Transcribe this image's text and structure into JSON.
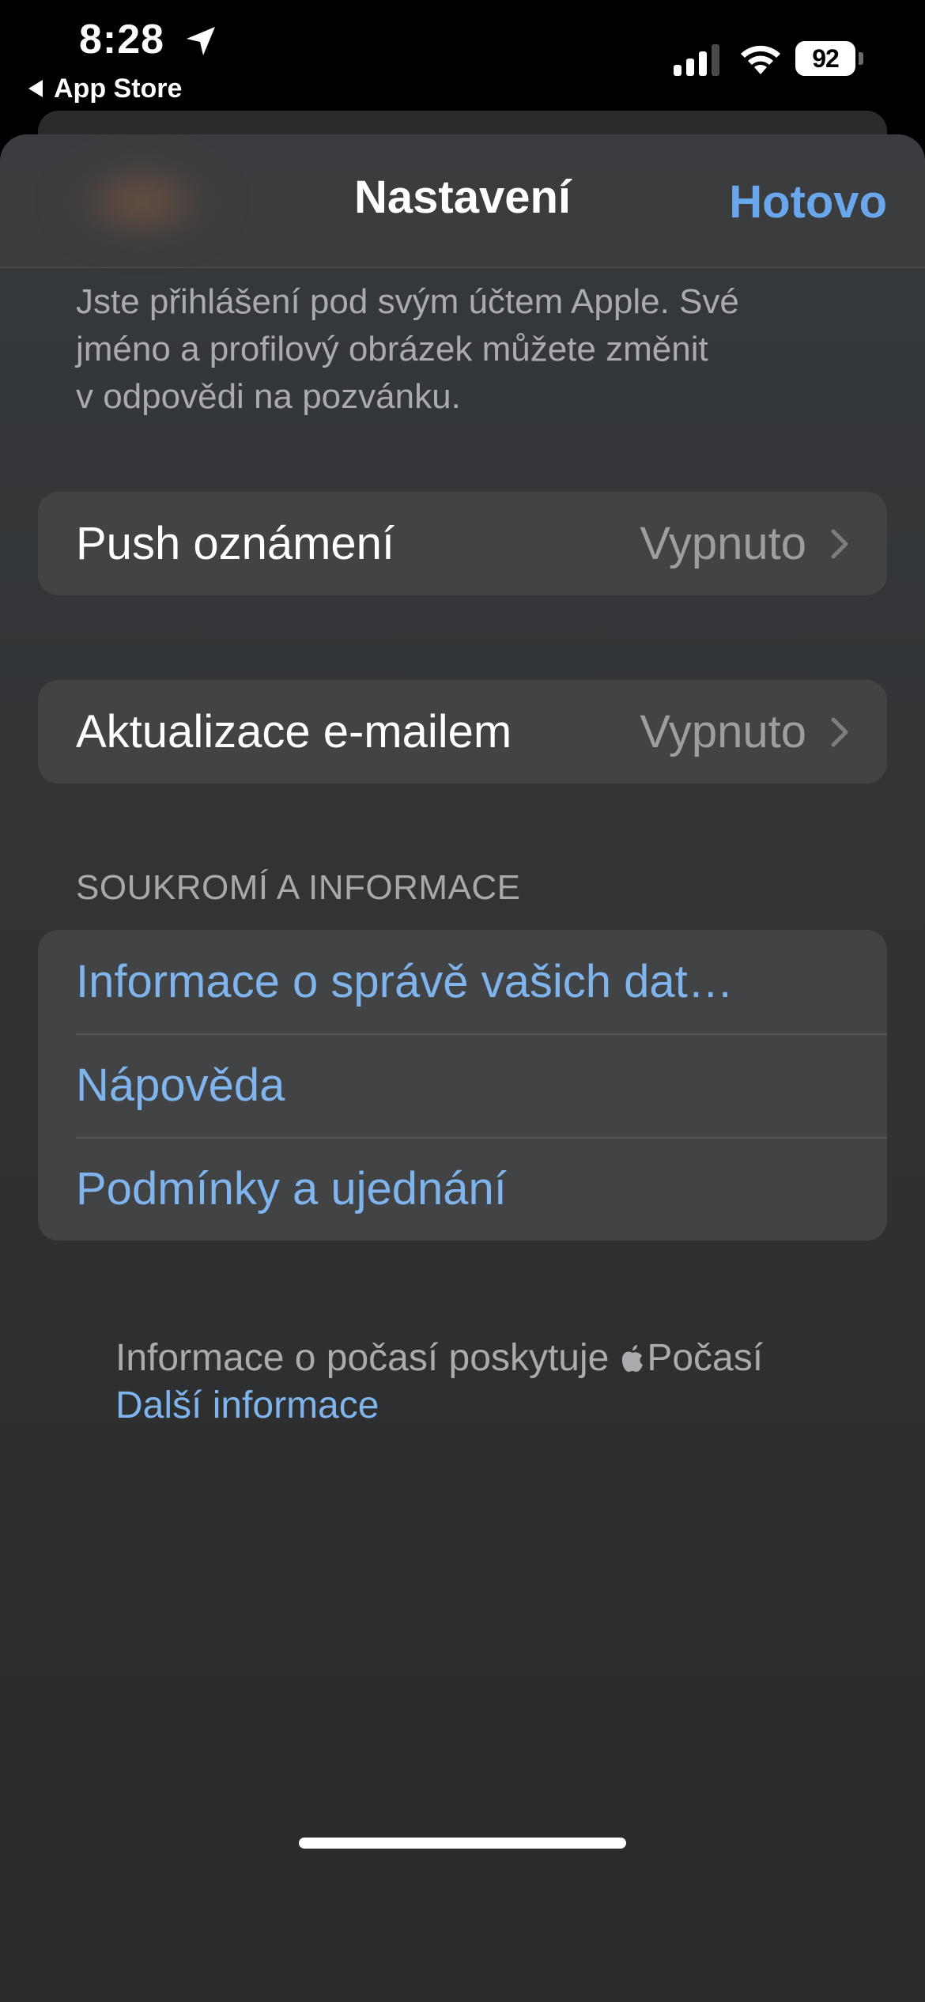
{
  "status_bar": {
    "time": "8:28",
    "back_label": "App Store",
    "battery": "92",
    "icons": [
      "location-arrow-icon",
      "cellular-signal-icon",
      "wifi-icon",
      "battery-icon"
    ]
  },
  "nav": {
    "title": "Nastavení",
    "done_label": "Hotovo"
  },
  "account_note": [
    "Jste přihlášení pod svým účtem Apple. Své",
    "jméno a profilový obrázek můžete změnit",
    "v odpovědi na pozvánku."
  ],
  "push": {
    "label": "Push oznámení",
    "value": "Vypnuto"
  },
  "email": {
    "label": "Aktualizace e-mailem",
    "value": "Vypnuto"
  },
  "privacy": {
    "header": "SOUKROMÍ A INFORMACE",
    "items": [
      {
        "label": "Informace o správě vašich dat…"
      },
      {
        "label": "Nápověda"
      },
      {
        "label": "Podmínky a ujednání"
      }
    ]
  },
  "weather": {
    "text": "Informace o počasí poskytuje",
    "brand": "Počasí",
    "more_link": "Další informace"
  },
  "colors": {
    "accent": "#6aa6ec",
    "link": "#80b4ec",
    "secondary_text": "#a9abae",
    "group_background": "#414345"
  }
}
